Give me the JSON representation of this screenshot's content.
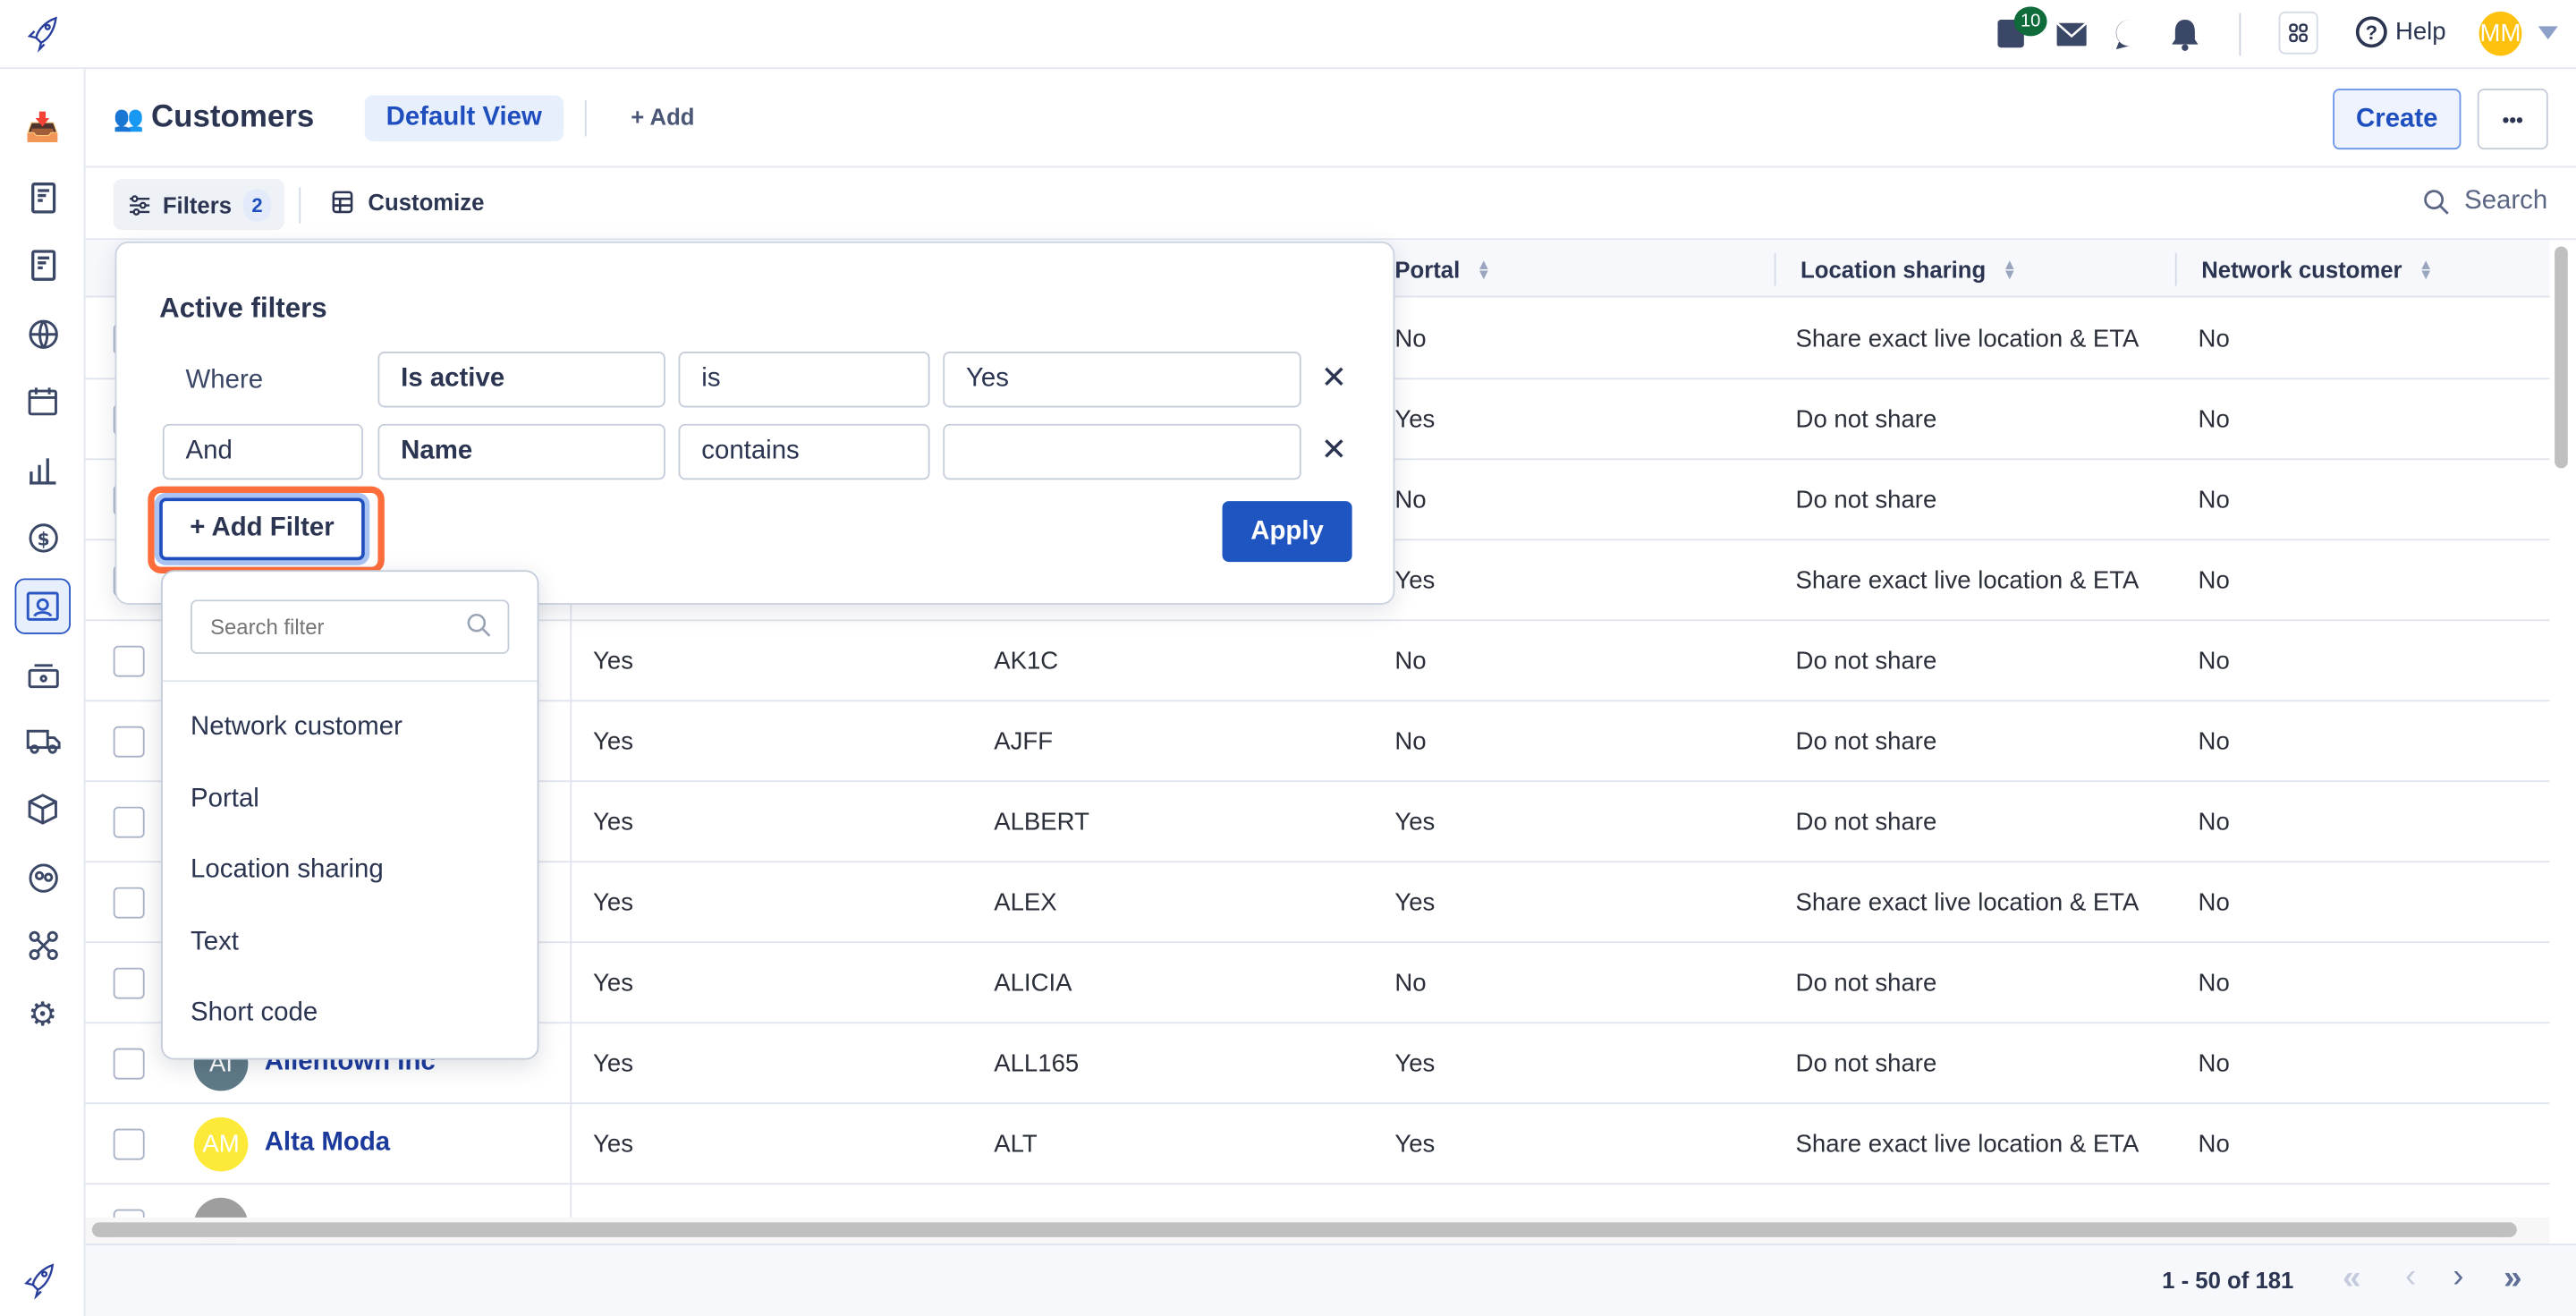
{
  "topbar": {
    "notes_badge": "10",
    "help_label": "Help",
    "avatar_initials": "MM",
    "avatar_color": "#fdc10e",
    "icons": [
      "rocket-logo-icon",
      "notes-icon",
      "mail-icon",
      "chat-icon",
      "bell-icon",
      "apps-grid-icon",
      "help-circle-icon",
      "caret-down-icon"
    ]
  },
  "sidebar": {
    "items": [
      "inbox",
      "orders",
      "invoices",
      "network",
      "calendar",
      "reports",
      "billing",
      "customers",
      "dispatch",
      "delivery",
      "inventory",
      "users",
      "integrations",
      "settings"
    ],
    "active": "customers"
  },
  "header": {
    "title": "Customers",
    "view_tab": "Default View",
    "add_label": "+ Add",
    "create_label": "Create",
    "more_label": "•••"
  },
  "toolbar": {
    "filters_label": "Filters",
    "filters_count": "2",
    "customize_label": "Customize",
    "search_label": "Search"
  },
  "table": {
    "columns": [
      "Portal",
      "Location sharing",
      "Network customer"
    ],
    "rows": [
      {
        "name": "",
        "initials": "",
        "avatar_color": "",
        "active": "",
        "code": "",
        "portal": "No",
        "location": "Share exact live location & ETA",
        "network": "No"
      },
      {
        "name": "",
        "initials": "",
        "avatar_color": "",
        "active": "",
        "code": "",
        "portal": "Yes",
        "location": "Do not share",
        "network": "No"
      },
      {
        "name": "",
        "initials": "",
        "avatar_color": "",
        "active": "",
        "code": "",
        "portal": "No",
        "location": "Do not share",
        "network": "No"
      },
      {
        "name": "",
        "initials": "",
        "avatar_color": "",
        "active": "",
        "code": "",
        "portal": "Yes",
        "location": "Share exact live location & ETA",
        "network": "No"
      },
      {
        "name": "",
        "initials": "",
        "avatar_color": "",
        "active": "Yes",
        "code": "AK1C",
        "portal": "No",
        "location": "Do not share",
        "network": "No"
      },
      {
        "name": "",
        "initials": "",
        "avatar_color": "",
        "active": "Yes",
        "code": "AJFF",
        "portal": "No",
        "location": "Do not share",
        "network": "No"
      },
      {
        "name": "",
        "initials": "",
        "avatar_color": "",
        "active": "Yes",
        "code": "ALBERT",
        "portal": "Yes",
        "location": "Do not share",
        "network": "No"
      },
      {
        "name": "",
        "initials": "",
        "avatar_color": "",
        "active": "Yes",
        "code": "ALEX",
        "portal": "Yes",
        "location": "Share exact live location & ETA",
        "network": "No"
      },
      {
        "name": "",
        "initials": "",
        "avatar_color": "",
        "active": "Yes",
        "code": "ALICIA",
        "portal": "No",
        "location": "Do not share",
        "network": "No"
      },
      {
        "name": "Allentown Inc",
        "initials": "AI",
        "avatar_color": "#5f7a87",
        "active": "Yes",
        "code": "ALL165",
        "portal": "Yes",
        "location": "Do not share",
        "network": "No"
      },
      {
        "name": "Alta Moda",
        "initials": "AM",
        "avatar_color": "#fde93a",
        "active": "Yes",
        "code": "ALT",
        "portal": "Yes",
        "location": "Share exact live location & ETA",
        "network": "No"
      },
      {
        "name": "",
        "initials": "",
        "avatar_color": "#9e9e9e",
        "active": "",
        "code": "",
        "portal": "",
        "location": "",
        "network": ""
      }
    ]
  },
  "filter_panel": {
    "title": "Active filters",
    "rows": [
      {
        "conjunction": "Where",
        "field": "Is active",
        "operator": "is",
        "value": "Yes"
      },
      {
        "conjunction": "And",
        "field": "Name",
        "operator": "contains",
        "value": ""
      }
    ],
    "add_filter_label": "+ Add Filter",
    "apply_label": "Apply",
    "highlight_color": "#ff6d3b"
  },
  "filter_dropdown": {
    "search_placeholder": "Search filter",
    "options": [
      "Network customer",
      "Portal",
      "Location sharing",
      "Text",
      "Short code"
    ]
  },
  "pagination": {
    "range_label": "1 - 50 of 181"
  }
}
